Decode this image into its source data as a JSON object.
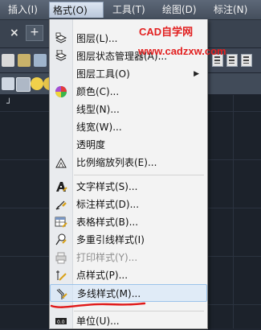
{
  "menubar": {
    "items": [
      {
        "label": "插入(I)"
      },
      {
        "label": "格式(O)"
      },
      {
        "label": "工具(T)"
      },
      {
        "label": "绘图(D)"
      },
      {
        "label": "标注(N)"
      }
    ]
  },
  "watermark": {
    "line1": "CAD自学网",
    "line2": "www.cadzxw.com",
    "color": "#e22020"
  },
  "format_menu": {
    "items": [
      {
        "label": "图层(L)...",
        "icon": "layers-icon",
        "disabled": false
      },
      {
        "label": "图层状态管理器(A)...",
        "icon": "layer-state-manager-icon",
        "disabled": false
      },
      {
        "label": "图层工具(O)",
        "icon": "",
        "disabled": false,
        "submenu": true,
        "submenu_arrow": "▶"
      },
      {
        "label": "颜色(C)...",
        "icon": "color-wheel-icon",
        "disabled": false
      },
      {
        "label": "线型(N)...",
        "icon": "",
        "disabled": false
      },
      {
        "label": "线宽(W)...",
        "icon": "",
        "disabled": false
      },
      {
        "label": "透明度",
        "icon": "",
        "disabled": false
      },
      {
        "label": "比例缩放列表(E)...",
        "icon": "scale-list-icon",
        "disabled": false
      },
      {
        "label": "文字样式(S)...",
        "icon": "text-style-icon",
        "disabled": false
      },
      {
        "label": "标注样式(D)...",
        "icon": "dimension-style-icon",
        "disabled": false
      },
      {
        "label": "表格样式(B)...",
        "icon": "table-style-icon",
        "disabled": false
      },
      {
        "label": "多重引线样式(I)",
        "icon": "multileader-style-icon",
        "disabled": false
      },
      {
        "label": "打印样式(Y)...",
        "icon": "plot-style-icon",
        "disabled": true
      },
      {
        "label": "点样式(P)...",
        "icon": "point-style-icon",
        "disabled": false
      },
      {
        "label": "多线样式(M)...",
        "icon": "multiline-style-icon",
        "disabled": false,
        "highlighted": true
      },
      {
        "label": "单位(U)...",
        "icon": "units-icon",
        "disabled": false
      }
    ]
  },
  "colors": {
    "highlight_underline": "#e01818",
    "menu_bg": "#f3f3f3",
    "app_bg": "#1f2530"
  }
}
